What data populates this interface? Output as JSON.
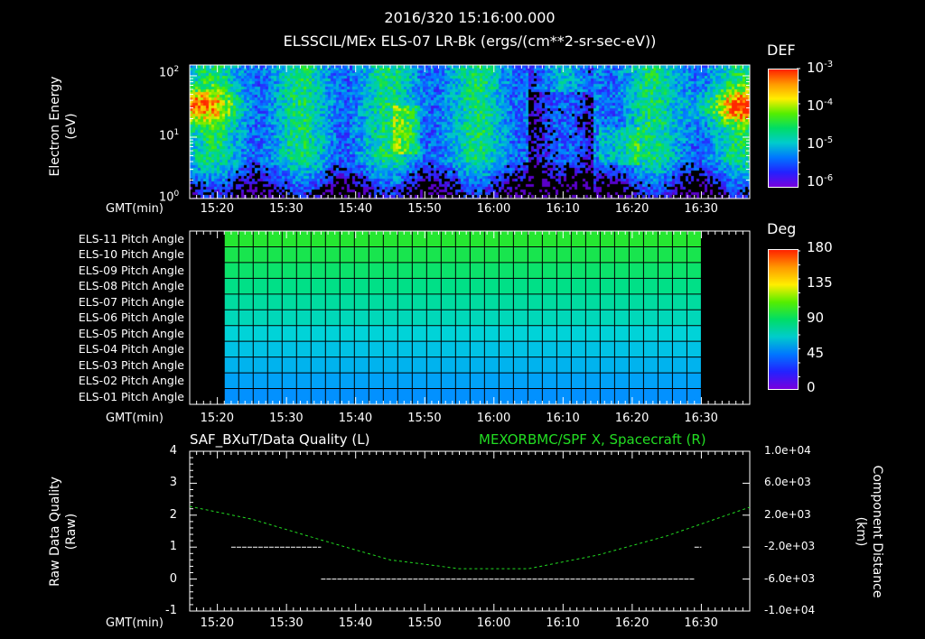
{
  "header": {
    "timestamp": "2016/320 15:16:00.000",
    "title": "ELSSCIL/MEx ELS-07 LR-Bk  (ergs/(cm**2-sr-sec-eV))"
  },
  "axis_label_gmt": "GMT(min)",
  "time_ticks": [
    "15:20",
    "15:30",
    "15:40",
    "15:50",
    "16:00",
    "16:10",
    "16:20",
    "16:30"
  ],
  "chart_data": [
    {
      "type": "heatmap",
      "title": "ELSSCIL/MEx ELS-07 LR-Bk  (ergs/(cm**2-sr-sec-eV))",
      "ylabel_line1": "Electron Energy",
      "ylabel_line2": "(eV)",
      "xlabel": "GMT(min)",
      "xlim": [
        "15:16",
        "16:37"
      ],
      "ylim": [
        1,
        150
      ],
      "yscale": "log",
      "y_ticks": [
        {
          "base": "10",
          "exp": "0"
        },
        {
          "base": "10",
          "exp": "1"
        },
        {
          "base": "10",
          "exp": "2"
        }
      ],
      "colorbar": {
        "label": "DEF",
        "scale": "log",
        "range": [
          1e-06,
          0.001
        ],
        "ticks": [
          {
            "base": "10",
            "exp": "-3"
          },
          {
            "base": "10",
            "exp": "-4"
          },
          {
            "base": "10",
            "exp": "-5"
          },
          {
            "base": "10",
            "exp": "-6"
          }
        ]
      }
    },
    {
      "type": "heatmap",
      "ylabel_rows": [
        "ELS-11 Pitch Angle",
        "ELS-10 Pitch Angle",
        "ELS-09 Pitch Angle",
        "ELS-08 Pitch Angle",
        "ELS-07 Pitch Angle",
        "ELS-06 Pitch Angle",
        "ELS-05 Pitch Angle",
        "ELS-04 Pitch Angle",
        "ELS-03 Pitch Angle",
        "ELS-02 Pitch Angle",
        "ELS-01 Pitch Angle"
      ],
      "row_values_deg": [
        112,
        108,
        104,
        100,
        96,
        92,
        87,
        82,
        77,
        72,
        67
      ],
      "data_xlim": [
        "15:21",
        "16:30"
      ],
      "colorbar": {
        "label": "Deg",
        "range": [
          0,
          180
        ],
        "ticks": [
          "180",
          "135",
          "90",
          "45",
          "0"
        ]
      }
    },
    {
      "type": "line",
      "left_title": "SAF_BXuT/Data Quality (L)",
      "right_title": "MEXORBMC/SPF X, Spacecraft (R)",
      "ylabel_left_line1": "Raw Data Quality",
      "ylabel_left_line2": "(Raw)",
      "ylabel_right_line1": "Component Distance",
      "ylabel_right_line2": "(km)",
      "ylim_left": [
        -1,
        4
      ],
      "yticks_left": [
        "4",
        "3",
        "2",
        "1",
        "0",
        "-1"
      ],
      "ylim_right": [
        -10000,
        10000
      ],
      "yticks_right": [
        "1.0e+04",
        "6.0e+03",
        "2.0e+03",
        "-2.0e+03",
        "-6.0e+03",
        "-1.0e+04"
      ],
      "series": [
        {
          "name": "SAF_BXuT/Data Quality",
          "axis": "left",
          "color": "#ffffff",
          "segments": [
            {
              "x": [
                "15:22",
                "15:35"
              ],
              "y": 1
            },
            {
              "x": [
                "15:35",
                "16:29"
              ],
              "y": 0
            },
            {
              "x": [
                "16:29",
                "16:30"
              ],
              "y": 1
            }
          ]
        },
        {
          "name": "MEXORBMC/SPF X, Spacecraft",
          "axis": "right",
          "color": "#22dd22",
          "x": [
            "15:16",
            "15:25",
            "15:35",
            "15:45",
            "15:55",
            "16:05",
            "16:15",
            "16:25",
            "16:37"
          ],
          "y": [
            3100,
            1500,
            -1100,
            -3600,
            -4700,
            -4700,
            -3000,
            -600,
            3000
          ]
        }
      ]
    }
  ]
}
